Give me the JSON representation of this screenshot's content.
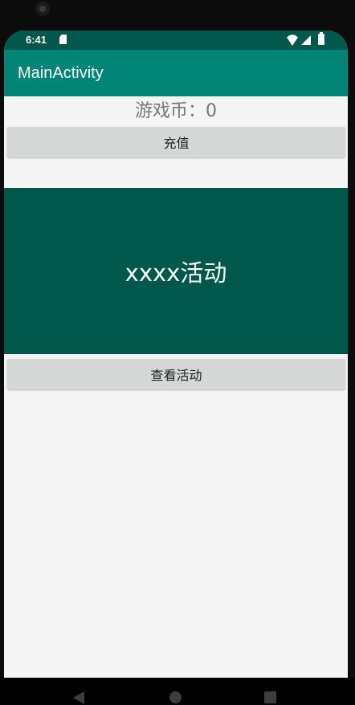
{
  "status_bar": {
    "time": "6:41",
    "icons": [
      "sd-card-icon",
      "wifi-icon",
      "signal-icon",
      "battery-icon"
    ]
  },
  "app_bar": {
    "title": "MainActivity"
  },
  "main": {
    "coins_label": "游戏币：0",
    "recharge_button": "充值",
    "activity_banner": "xxxx活动",
    "view_activity_button": "查看活动"
  },
  "nav_bar": {
    "icons": [
      "back-icon",
      "home-icon",
      "recents-icon"
    ]
  },
  "colors": {
    "primary": "#008577",
    "primary_dark": "#00574b",
    "background": "#f5f5f5",
    "button": "#d6d7d7",
    "coins_text": "#757575"
  }
}
